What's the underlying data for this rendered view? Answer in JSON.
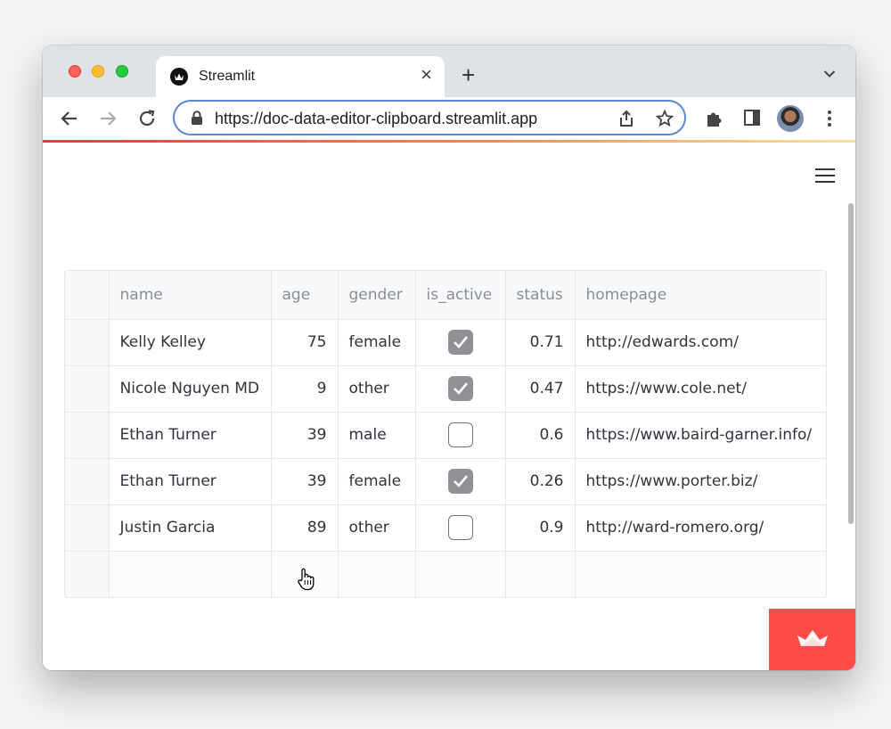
{
  "browser": {
    "tab_title": "Streamlit",
    "url": "https://doc-data-editor-clipboard.streamlit.app",
    "load_bar_colors": [
      "#e9383f",
      "#f38b4a",
      "#f6e49a"
    ]
  },
  "app": {
    "accent_color": "#ff4b4b",
    "table": {
      "columns": [
        "name",
        "age",
        "gender",
        "is_active",
        "status",
        "homepage"
      ],
      "rows": [
        {
          "name": "Kelly Kelley",
          "age": "75",
          "gender": "female",
          "is_active": true,
          "status": "0.71",
          "homepage": "http://edwards.com/"
        },
        {
          "name": "Nicole Nguyen MD",
          "age": "9",
          "gender": "other",
          "is_active": true,
          "status": "0.47",
          "homepage": "https://www.cole.net/"
        },
        {
          "name": "Ethan Turner",
          "age": "39",
          "gender": "male",
          "is_active": false,
          "status": "0.6",
          "homepage": "https://www.baird-garner.info/"
        },
        {
          "name": "Ethan Turner",
          "age": "39",
          "gender": "female",
          "is_active": true,
          "status": "0.26",
          "homepage": "https://www.porter.biz/"
        },
        {
          "name": "Justin Garcia",
          "age": "89",
          "gender": "other",
          "is_active": false,
          "status": "0.9",
          "homepage": "http://ward-romero.org/"
        }
      ]
    }
  }
}
